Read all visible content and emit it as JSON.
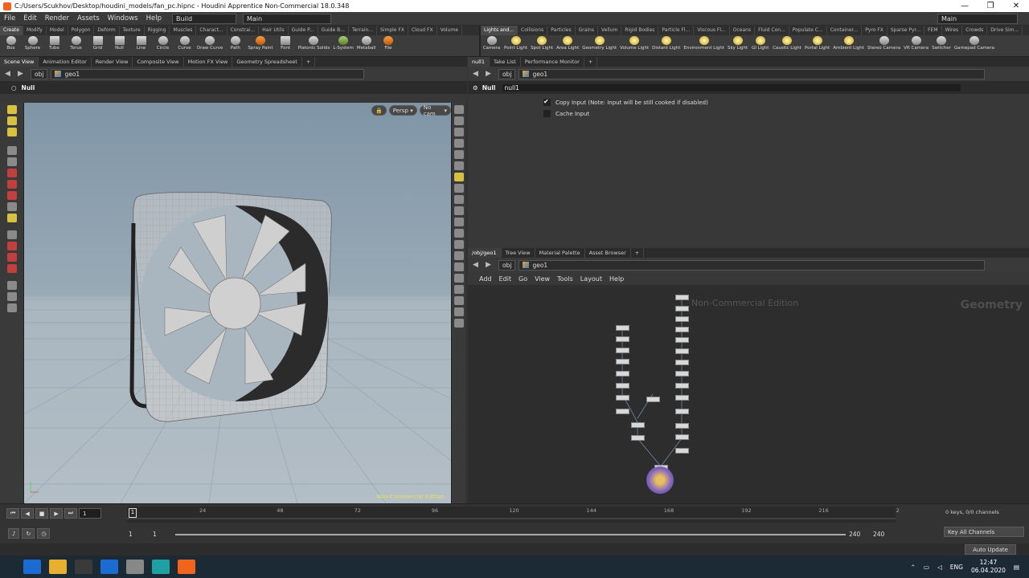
{
  "window": {
    "title": "C:/Users/Scukhov/Desktop/houdini_models/fan_pc.hipnc - Houdini Apprentice Non-Commercial 18.0.348"
  },
  "menubar": {
    "items": [
      "File",
      "Edit",
      "Render",
      "Assets",
      "Windows",
      "Help"
    ],
    "build": "Build",
    "main_desktop": "Main",
    "main_right": "Main"
  },
  "shelf_tabs_left": [
    "Create",
    "Modify",
    "Model",
    "Polygon",
    "Deform",
    "Texture",
    "Rigging",
    "Muscles",
    "Charact...",
    "Constrai...",
    "Hair Utils",
    "Guide P...",
    "Guide B...",
    "Terrain...",
    "Simple FX",
    "Cloud FX",
    "Volume"
  ],
  "shelf_tabs_right": [
    "Lights and...",
    "Collisions",
    "Particles",
    "Grains",
    "Vellum",
    "Rigid Bodies",
    "Particle Fl...",
    "Viscous Fl...",
    "Oceans",
    "Fluid Con...",
    "Populate C...",
    "Container...",
    "Pyro FX",
    "Sparse Pyr...",
    "FEM",
    "Wires",
    "Crowds",
    "Drive Sim..."
  ],
  "shelf_tools_left": [
    "Box",
    "Sphere",
    "Tube",
    "Torus",
    "Grid",
    "Null",
    "Line",
    "Circle",
    "Curve",
    "Draw Curve",
    "Path",
    "Spray Paint",
    "Font",
    "Platonic Solids",
    "L-System",
    "Metaball",
    "File"
  ],
  "shelf_tools_right": [
    "Camera",
    "Point Light",
    "Spot Light",
    "Area Light",
    "Geometry Light",
    "Volume Light",
    "Distant Light",
    "Environment Light",
    "Sky Light",
    "GI Light",
    "Caustic Light",
    "Portal Light",
    "Ambient Light",
    "Stereo Camera",
    "VR Camera",
    "Switcher",
    "Gamepad Camera"
  ],
  "left_tabs": [
    "Scene View",
    "Animation Editor",
    "Render View",
    "Composite View",
    "Motion FX View",
    "Geometry Spreadsheet"
  ],
  "right_tabs": [
    "null1",
    "Take List",
    "Performance Monitor"
  ],
  "net_tabs": [
    "/obj/geo1",
    "Tree View",
    "Material Palette",
    "Asset Browser"
  ],
  "path": {
    "obj": "obj",
    "geo": "geo1"
  },
  "viewer": {
    "node_type": "Null",
    "persp": "Persp",
    "cam": "No cam",
    "watermark": "Non-Commercial Edition"
  },
  "params": {
    "node_type": "Null",
    "node_name": "null1",
    "copy_input": "Copy Input (Note: Input will be still cooked if disabled)",
    "cache_input": "Cache Input"
  },
  "network": {
    "menu": [
      "Add",
      "Edit",
      "Go",
      "View",
      "Tools",
      "Layout",
      "Help"
    ],
    "watermark": "Non-Commercial Edition",
    "context": "Geometry"
  },
  "timeline": {
    "frame": "1",
    "ticks": [
      "24",
      "48",
      "72",
      "96",
      "120",
      "144",
      "168",
      "192",
      "216",
      "2"
    ],
    "start": "1",
    "start2": "1",
    "end": "240",
    "end2": "240",
    "keys": "0 keys, 0/0 channels",
    "key_all": "Key All Channels",
    "auto_update": "Auto Update"
  },
  "taskbar": {
    "lang": "ENG",
    "time": "12:47",
    "date": "06.04.2020"
  },
  "colors": {
    "viewport_sky": "#7f95a6",
    "viewport_ground": "#b3bec6",
    "accent": "#f0641e"
  }
}
